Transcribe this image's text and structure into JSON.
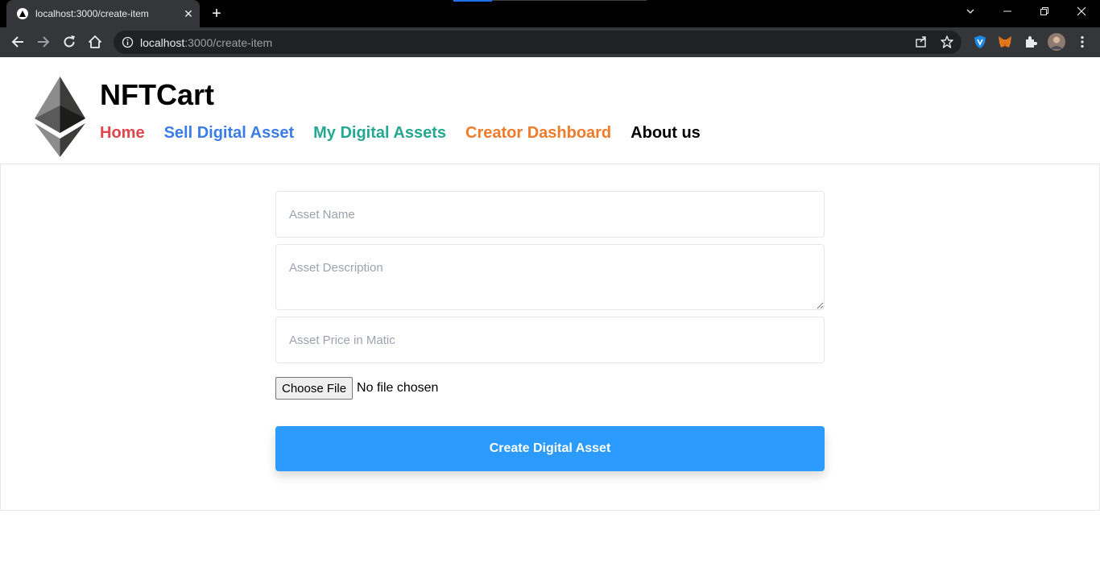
{
  "browser": {
    "tab_title": "localhost:3000/create-item",
    "tab_close": "✕",
    "new_tab": "+",
    "url_host": "localhost",
    "url_path": ":3000/create-item",
    "window_controls": {
      "minimize": "—",
      "restore": "❐",
      "close": "✕",
      "tab_search": "⌄"
    }
  },
  "site": {
    "brand": "NFTCart",
    "nav": [
      {
        "label": "Home",
        "color": "#e0464b"
      },
      {
        "label": "Sell Digital Asset",
        "color": "#3b7de8"
      },
      {
        "label": "My Digital Assets",
        "color": "#25a891"
      },
      {
        "label": "Creator Dashboard",
        "color": "#f07b2a"
      },
      {
        "label": "About us",
        "color": "#000000"
      }
    ]
  },
  "form": {
    "name_placeholder": "Asset Name",
    "description_placeholder": "Asset Description",
    "price_placeholder": "Asset Price in Matic",
    "file_button": "Choose File",
    "file_status": "No file chosen",
    "submit_label": "Create Digital Asset",
    "submit_color": "#2b9bff"
  }
}
